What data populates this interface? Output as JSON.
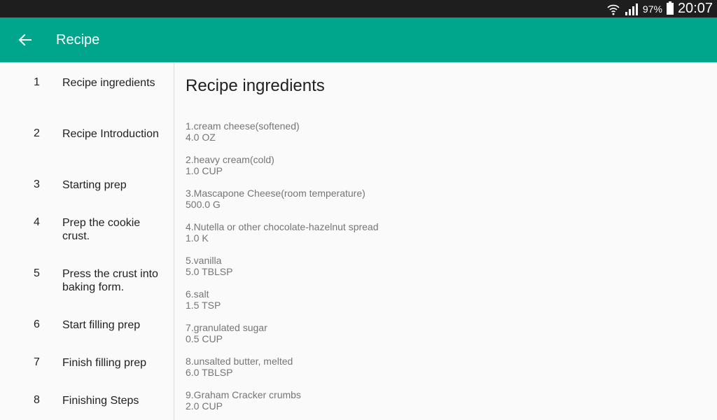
{
  "status_bar": {
    "battery_percent": "97%",
    "time": "20:07"
  },
  "app_bar": {
    "title": "Recipe",
    "back_icon": "arrow-back-icon"
  },
  "sidebar": {
    "items": [
      {
        "num": "1",
        "label": "Recipe ingredients"
      },
      {
        "num": "2",
        "label": "Recipe Introduction"
      },
      {
        "num": "3",
        "label": "Starting prep"
      },
      {
        "num": "4",
        "label": "Prep the cookie crust."
      },
      {
        "num": "5",
        "label": "Press the crust into baking form."
      },
      {
        "num": "6",
        "label": "Start filling prep"
      },
      {
        "num": "7",
        "label": "Finish filling prep"
      },
      {
        "num": "8",
        "label": "Finishing Steps"
      }
    ]
  },
  "content": {
    "title": "Recipe ingredients",
    "ingredients": [
      {
        "name": "1.cream cheese(softened)",
        "amount": "4.0 OZ"
      },
      {
        "name": "2.heavy cream(cold)",
        "amount": "1.0 CUP"
      },
      {
        "name": "3.Mascapone Cheese(room temperature)",
        "amount": "500.0 G"
      },
      {
        "name": "4.Nutella or other chocolate-hazelnut spread",
        "amount": "1.0 K"
      },
      {
        "name": "5.vanilla",
        "amount": "5.0 TBLSP"
      },
      {
        "name": "6.salt",
        "amount": "1.5 TSP"
      },
      {
        "name": "7.granulated sugar",
        "amount": "0.5 CUP"
      },
      {
        "name": "8.unsalted butter, melted",
        "amount": "6.0 TBLSP"
      },
      {
        "name": "9.Graham Cracker crumbs",
        "amount": "2.0 CUP"
      }
    ]
  },
  "colors": {
    "app_bar": "#00a68c",
    "status_bar": "#1e1e1e"
  }
}
